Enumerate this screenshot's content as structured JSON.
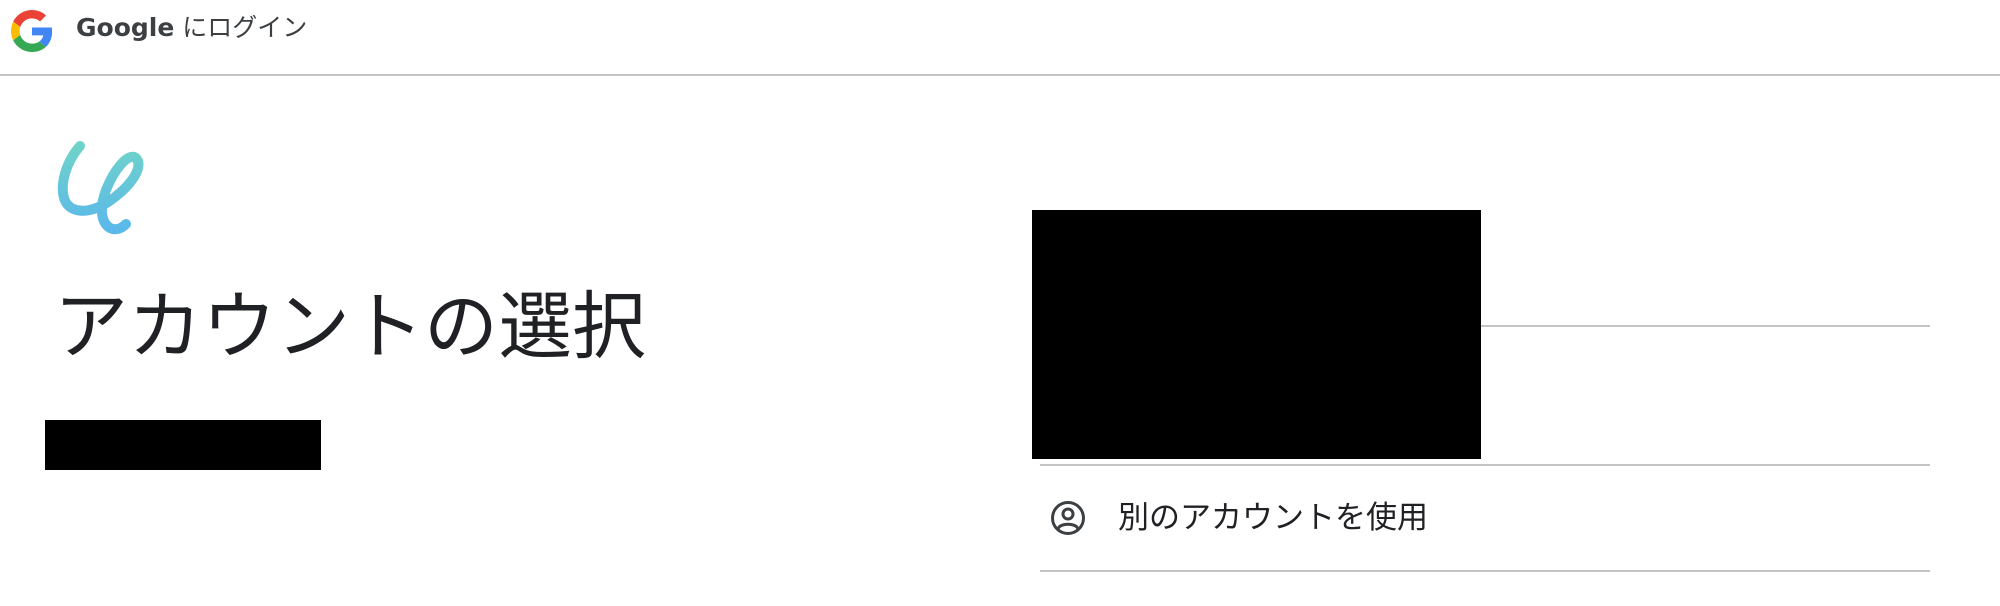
{
  "header": {
    "brand": "Google",
    "title": "にログイン"
  },
  "page": {
    "title": "アカウントの選択"
  },
  "accounts": {
    "use_other_label": "別のアカウントを使用"
  },
  "icons": {
    "header_logo": "google-g-icon",
    "app_logo": "app-logo-icon",
    "use_other": "account-circle-icon"
  },
  "colors": {
    "google_blue": "#4285F4",
    "google_red": "#EA4335",
    "google_yellow": "#FBBC05",
    "google_green": "#34A853",
    "app_logo_teal": "#6fd3c9",
    "app_logo_blue": "#5bb8ea",
    "divider": "#c4c4c4",
    "text": "#202124"
  }
}
